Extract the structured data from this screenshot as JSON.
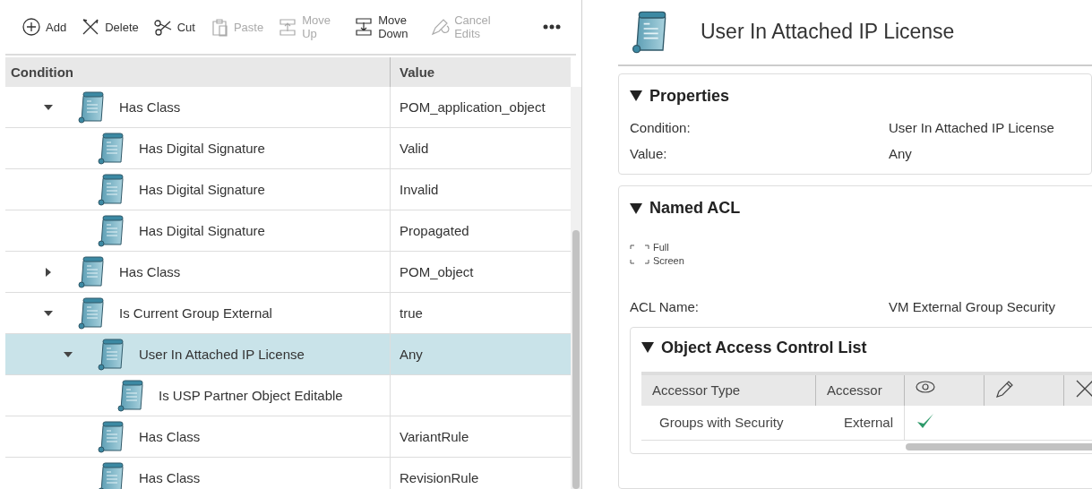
{
  "toolbar": [
    {
      "label": "Add",
      "disabled": false
    },
    {
      "label": "Delete",
      "disabled": false
    },
    {
      "label": "Cut",
      "disabled": false
    },
    {
      "label": "Paste",
      "disabled": true
    },
    {
      "label": "Move Up",
      "disabled": true
    },
    {
      "label": "Move Down",
      "disabled": false
    },
    {
      "label": "Cancel Edits",
      "disabled": true
    }
  ],
  "tree": {
    "columns": [
      "Condition",
      "Value"
    ],
    "rows": [
      {
        "condition": "Has Class",
        "value": "POM_application_object",
        "expanded": true,
        "selected": false,
        "children": [
          {
            "condition": "Has Digital Signature",
            "value": "Valid",
            "selected": false
          },
          {
            "condition": "Has Digital Signature",
            "value": "Invalid",
            "selected": false
          },
          {
            "condition": "Has Digital Signature",
            "value": "Propagated",
            "selected": false
          }
        ]
      },
      {
        "condition": "Has Class",
        "value": "POM_object",
        "expanded": false,
        "selected": false
      },
      {
        "condition": "Is Current Group External",
        "value": "true",
        "expanded": true,
        "selected": false,
        "children": [
          {
            "condition": "User In Attached IP License",
            "value": "Any",
            "expanded": true,
            "selected": true,
            "children": [
              {
                "condition": "Is USP Partner Object Editable",
                "selected": false
              }
            ]
          },
          {
            "condition": "Has Class",
            "value": "VariantRule",
            "selected": false
          },
          {
            "condition": "Has Class",
            "value": "RevisionRule",
            "selected": false
          }
        ]
      }
    ]
  },
  "details": {
    "title": "User In Attached IP License",
    "properties": {
      "title": "Properties",
      "fields": [
        {
          "label": "Condition:",
          "value": "User In Attached IP License"
        },
        {
          "label": "Value:",
          "value": "Any"
        }
      ]
    },
    "named_acl": {
      "title": "Named ACL",
      "full_screen": "Full Screen",
      "acl_name_label": "ACL Name:",
      "acl_name": "VM External Group Security",
      "access_list": {
        "title": "Object Access Control List",
        "columns": [
          "Accessor Type",
          "Accessor"
        ],
        "rows": [
          {
            "accessor_type": "Groups with Security",
            "accessor": "External",
            "permissions": [
              true,
              false,
              false
            ]
          }
        ]
      }
    }
  }
}
